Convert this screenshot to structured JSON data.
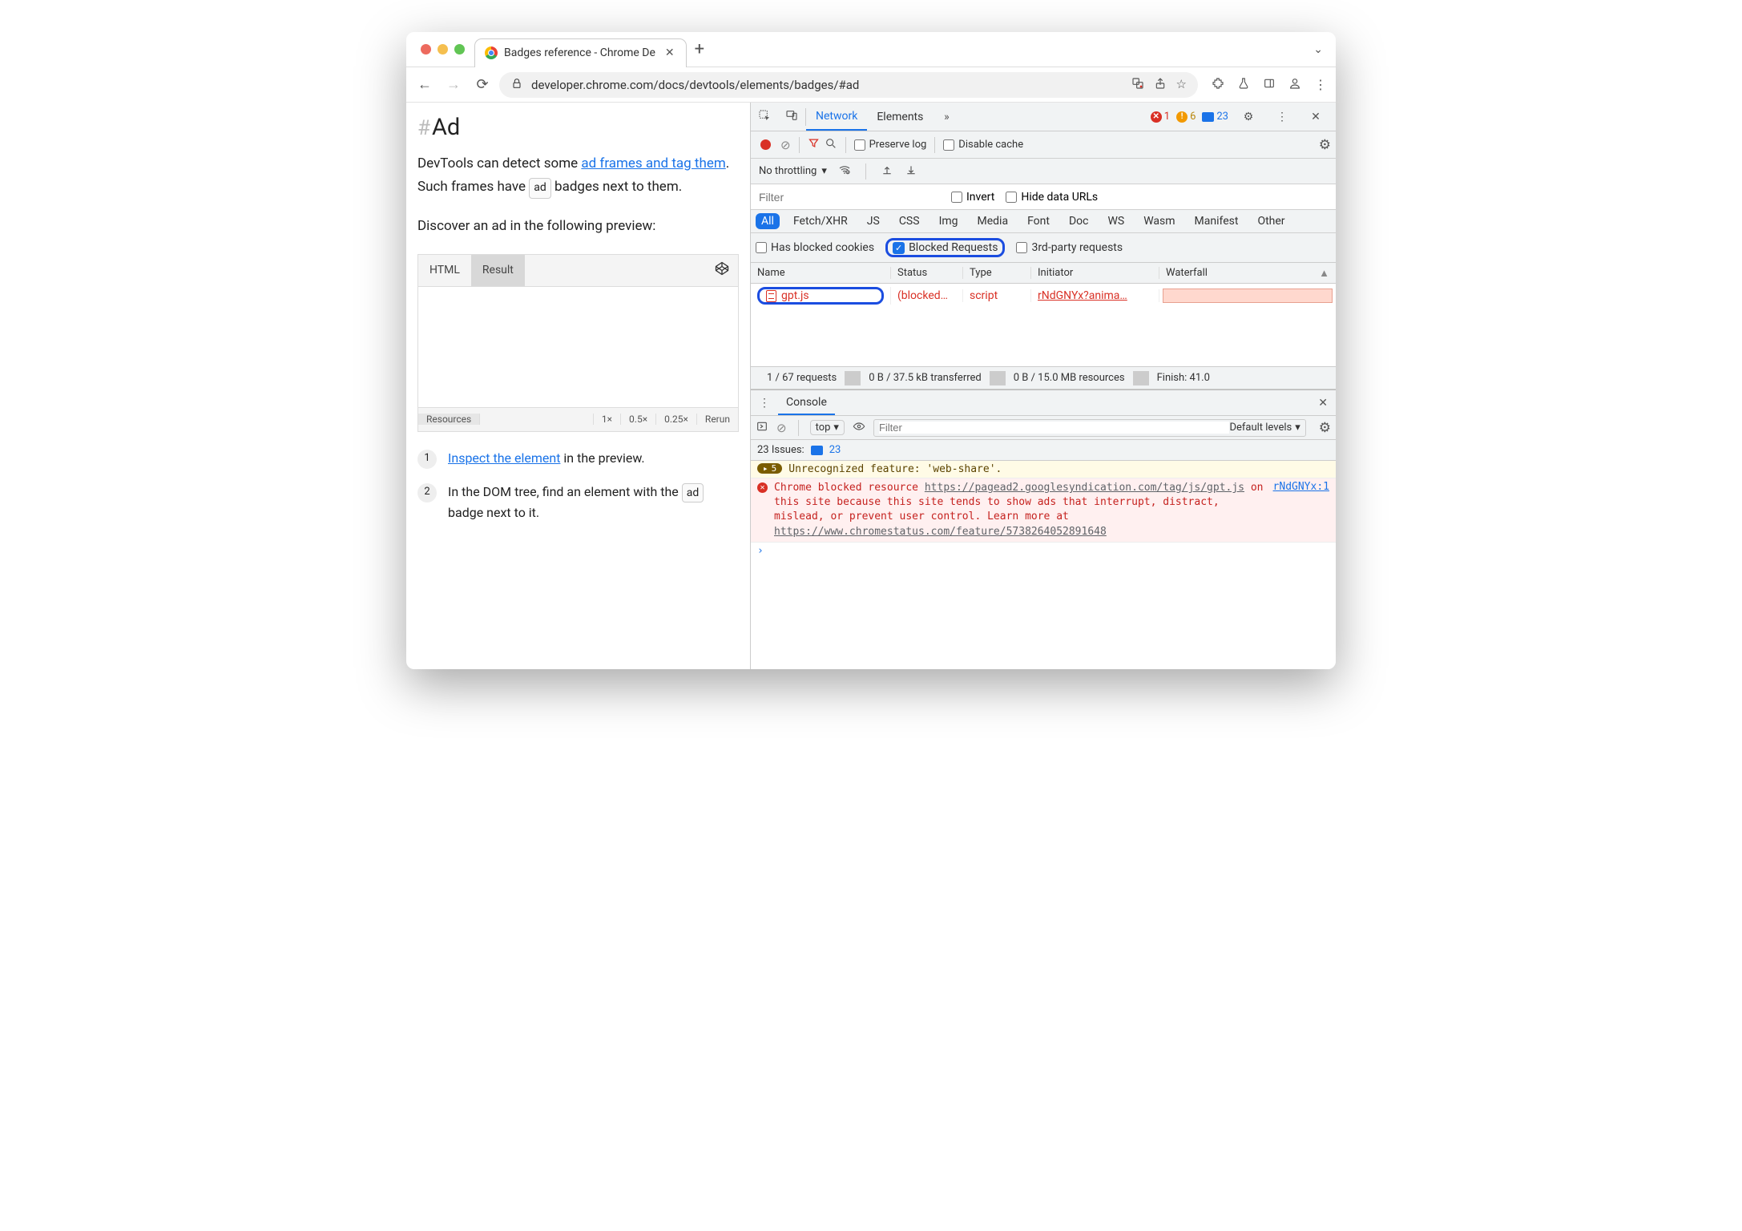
{
  "window": {
    "tab_title": "Badges reference - Chrome De",
    "url": "developer.chrome.com/docs/devtools/elements/badges/#ad"
  },
  "page": {
    "heading": "Ad",
    "p1_before": "DevTools can detect some ",
    "p1_link": "ad frames and tag them",
    "p1_after1": ". Such frames have ",
    "badge1": "ad",
    "p1_after2": " badges next to them.",
    "p2": "Discover an ad in the following preview:",
    "embed_tabs": {
      "html": "HTML",
      "result": "Result"
    },
    "embed_footer": {
      "resources": "Resources",
      "x1": "1×",
      "x05": "0.5×",
      "x025": "0.25×",
      "rerun": "Rerun"
    },
    "step1_link": "Inspect the element",
    "step1_after": " in the preview.",
    "step2_a": "In the DOM tree, find an element with the ",
    "step2_badge": "ad",
    "step2_b": " badge next to it."
  },
  "devtools": {
    "tabs": {
      "network": "Network",
      "elements": "Elements"
    },
    "counts": {
      "errors": "1",
      "warnings": "6",
      "messages": "23"
    },
    "toolbar": {
      "preserve": "Preserve log",
      "disable_cache": "Disable cache"
    },
    "throttling": "No throttling",
    "filter_placeholder": "Filter",
    "invert": "Invert",
    "hide_urls": "Hide data URLs",
    "types": [
      "All",
      "Fetch/XHR",
      "JS",
      "CSS",
      "Img",
      "Media",
      "Font",
      "Doc",
      "WS",
      "Wasm",
      "Manifest",
      "Other"
    ],
    "opts": {
      "blocked_cookies": "Has blocked cookies",
      "blocked_req": "Blocked Requests",
      "third_party": "3rd-party requests"
    },
    "columns": {
      "name": "Name",
      "status": "Status",
      "type": "Type",
      "initiator": "Initiator",
      "waterfall": "Waterfall"
    },
    "row": {
      "name": "gpt.js",
      "status": "(blocked…",
      "type": "script",
      "initiator": "rNdGNYx?anima…"
    },
    "status_bar": {
      "requests": "1 / 67 requests",
      "transferred": "0 B / 37.5 kB transferred",
      "resources": "0 B / 15.0 MB resources",
      "finish": "Finish: 41.0"
    }
  },
  "console": {
    "tab": "Console",
    "context": "top",
    "filter_placeholder": "Filter",
    "levels": "Default levels",
    "issues_label": "23 Issues:",
    "issues_count": "23",
    "warn_count": "5",
    "warn_text": "Unrecognized feature: 'web-share'.",
    "err_src": "rNdGNYx:1",
    "err_pre": "Chrome blocked resource ",
    "err_url": "https://pagead2.googlesyndication.com/tag/js/gpt.js",
    "err_mid": " on this site because this site tends to show ads that interrupt, distract, mislead, or prevent user control. Learn more at ",
    "err_url2": "https://www.chromestatus.com/feature/5738264052891648"
  }
}
